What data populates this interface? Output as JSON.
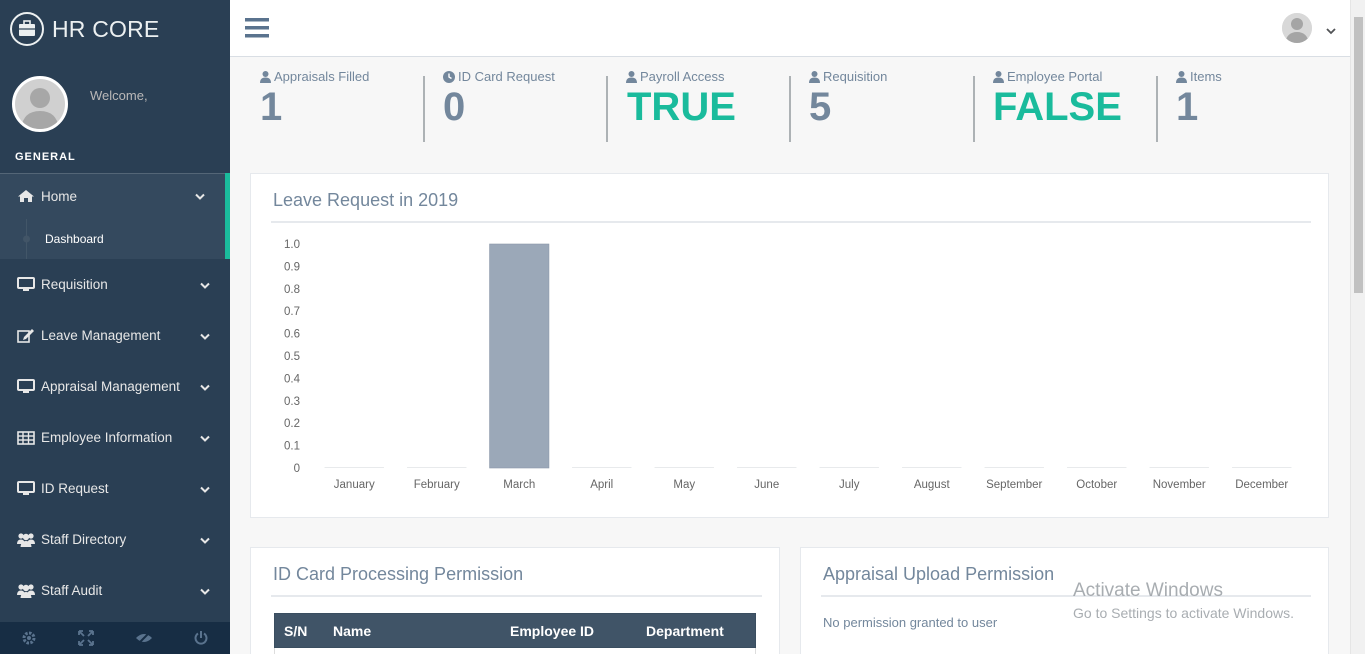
{
  "app": {
    "brand": "HR CORE",
    "welcome": "Welcome,",
    "section_title": "GENERAL",
    "accent_color": "#1ABB9C",
    "sidebar_color": "#2A3F54"
  },
  "sidebar": {
    "items": [
      {
        "label": "Home",
        "icon": "home-icon"
      },
      {
        "label": "Dashboard",
        "icon": "dot"
      },
      {
        "label": "Requisition",
        "icon": "desktop-icon"
      },
      {
        "label": "Leave Management",
        "icon": "edit-icon"
      },
      {
        "label": "Appraisal Management",
        "icon": "desktop-icon"
      },
      {
        "label": "Employee Information",
        "icon": "table-icon"
      },
      {
        "label": "ID Request",
        "icon": "desktop-icon"
      },
      {
        "label": "Staff Directory",
        "icon": "users-icon"
      },
      {
        "label": "Staff Audit",
        "icon": "users-icon"
      }
    ],
    "footer_icons": [
      "settings-icon",
      "fullscreen-icon",
      "hide-icon",
      "power-icon"
    ]
  },
  "tiles": [
    {
      "label": "Appraisals Filled",
      "value": "1",
      "icon": "user-icon"
    },
    {
      "label": "ID Card Request",
      "value": "0",
      "icon": "clock-icon"
    },
    {
      "label": "Payroll Access",
      "value": "TRUE",
      "icon": "user-icon"
    },
    {
      "label": "Requisition",
      "value": "5",
      "icon": "user-icon"
    },
    {
      "label": "Employee Portal",
      "value": "FALSE",
      "icon": "user-icon"
    },
    {
      "label": "Items",
      "value": "1",
      "icon": "user-icon"
    }
  ],
  "chart_panel": {
    "title": "Leave Request in 2019"
  },
  "chart_data": {
    "type": "bar",
    "title": "",
    "categories": [
      "January",
      "February",
      "March",
      "April",
      "May",
      "June",
      "July",
      "August",
      "September",
      "October",
      "November",
      "December"
    ],
    "values": [
      0,
      0,
      1,
      0,
      0,
      0,
      0,
      0,
      0,
      0,
      0,
      0
    ],
    "ylim": [
      0,
      1.0
    ],
    "yticks": [
      "0",
      "0.1",
      "0.2",
      "0.3",
      "0.4",
      "0.5",
      "0.6",
      "0.7",
      "0.8",
      "0.9",
      "1.0"
    ],
    "bar_color": "#9BA8B8",
    "grid": false
  },
  "id_panel": {
    "title": "ID Card Processing Permission",
    "columns": [
      "S/N",
      "Name",
      "Employee ID",
      "Department"
    ]
  },
  "appraisal_panel": {
    "title": "Appraisal Upload Permission",
    "message": "No permission granted to user"
  },
  "watermark": {
    "line1": "Activate Windows",
    "line2": "Go to Settings to activate Windows."
  }
}
